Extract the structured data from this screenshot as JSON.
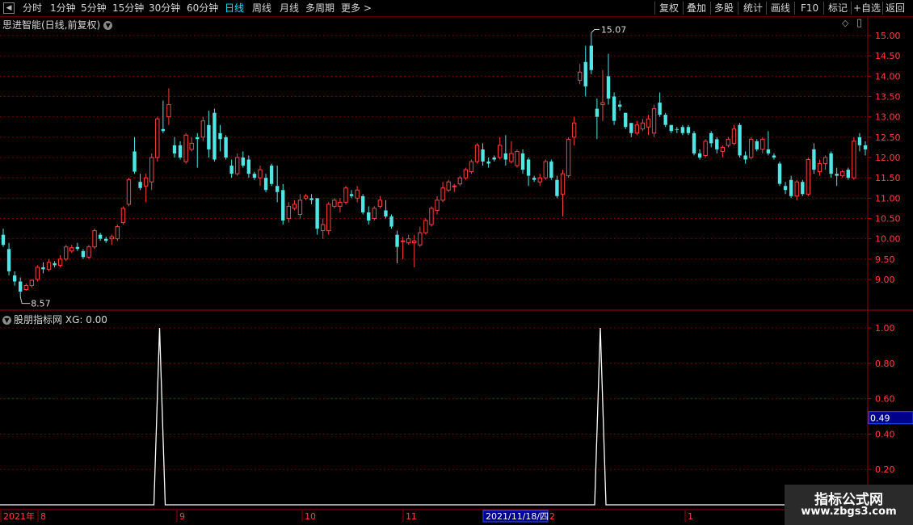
{
  "toolbar": {
    "periods": [
      "分时",
      "1分钟",
      "5分钟",
      "15分钟",
      "30分钟",
      "60分钟",
      "日线",
      "周线",
      "月线",
      "多周期",
      "更多"
    ],
    "active_period": "日线",
    "actions": [
      "复权",
      "叠加",
      "多股",
      "统计",
      "画线",
      "F10",
      "标记",
      "+自选",
      "返回"
    ]
  },
  "main_panel": {
    "title": "思进智能(日线,前复权)",
    "y_labels": [
      "15.00",
      "14.50",
      "14.00",
      "13.50",
      "13.00",
      "12.50",
      "12.00",
      "11.50",
      "11.00",
      "10.50",
      "10.00",
      "9.50",
      "9.00"
    ],
    "high_label": "15.07",
    "low_label": "8.57"
  },
  "indicator_panel": {
    "title": "股朋指标网",
    "series_label": "XG: 0.00",
    "y_labels": [
      "1.00",
      "0.80",
      "0.60",
      "0.40",
      "0.20"
    ],
    "cursor_value": "0.49"
  },
  "x_axis": {
    "labels": [
      "2021年",
      "8",
      "9",
      "10",
      "11",
      "2",
      "1"
    ],
    "cursor_date": "2021/11/18/四"
  },
  "watermark": {
    "title": "指标公式网",
    "url": "www.zbgs3.com"
  },
  "colors": {
    "up": "#ff4040",
    "down": "#50e6e6",
    "grid": "#6e0000",
    "cursor": "#00008b"
  },
  "chart_data": {
    "type": "candlestick",
    "title": "思进智能(日线,前复权)",
    "ylim": [
      8.3,
      15.3
    ],
    "candles_ohlc": [
      [
        10.1,
        10.25,
        9.8,
        9.85
      ],
      [
        9.75,
        9.9,
        9.1,
        9.2
      ],
      [
        9.1,
        9.2,
        8.85,
        8.95
      ],
      [
        8.95,
        9.05,
        8.57,
        8.7
      ],
      [
        8.75,
        8.9,
        8.72,
        8.85
      ],
      [
        8.85,
        9.0,
        8.8,
        8.98
      ],
      [
        9.0,
        9.35,
        8.95,
        9.3
      ],
      [
        9.3,
        9.42,
        9.15,
        9.25
      ],
      [
        9.25,
        9.5,
        9.2,
        9.42
      ],
      [
        9.4,
        9.45,
        9.3,
        9.35
      ],
      [
        9.35,
        9.6,
        9.3,
        9.5
      ],
      [
        9.5,
        9.85,
        9.45,
        9.8
      ],
      [
        9.7,
        9.85,
        9.65,
        9.78
      ],
      [
        9.8,
        9.9,
        9.7,
        9.75
      ],
      [
        9.7,
        9.75,
        9.5,
        9.55
      ],
      [
        9.55,
        9.85,
        9.5,
        9.8
      ],
      [
        9.8,
        10.25,
        9.75,
        10.2
      ],
      [
        10.1,
        10.15,
        9.95,
        10.0
      ],
      [
        10.0,
        10.05,
        9.9,
        9.95
      ],
      [
        10.0,
        10.1,
        9.85,
        10.05
      ],
      [
        10.0,
        10.35,
        9.95,
        10.3
      ],
      [
        10.4,
        10.8,
        10.35,
        10.75
      ],
      [
        10.85,
        11.5,
        10.8,
        11.45
      ],
      [
        12.15,
        12.5,
        11.6,
        11.65
      ],
      [
        11.4,
        11.6,
        11.2,
        11.25
      ],
      [
        11.3,
        11.6,
        10.9,
        11.5
      ],
      [
        11.4,
        12.1,
        11.2,
        12.0
      ],
      [
        12.0,
        13.0,
        11.9,
        12.95
      ],
      [
        12.7,
        13.4,
        12.6,
        12.65
      ],
      [
        13.0,
        13.7,
        12.8,
        13.3
      ],
      [
        12.3,
        12.5,
        12.0,
        12.1
      ],
      [
        12.3,
        12.4,
        11.95,
        12.0
      ],
      [
        11.9,
        12.6,
        11.85,
        12.55
      ],
      [
        12.2,
        12.5,
        12.15,
        12.35
      ],
      [
        12.5,
        12.6,
        11.75,
        12.45
      ],
      [
        12.5,
        13.0,
        12.4,
        12.9
      ],
      [
        12.8,
        13.15,
        12.0,
        12.2
      ],
      [
        13.1,
        13.2,
        11.9,
        11.95
      ],
      [
        12.6,
        12.8,
        12.15,
        12.45
      ],
      [
        12.5,
        12.55,
        11.95,
        12.0
      ],
      [
        11.8,
        11.95,
        11.5,
        11.6
      ],
      [
        11.6,
        12.1,
        11.55,
        12.0
      ],
      [
        12.0,
        12.15,
        11.75,
        11.8
      ],
      [
        11.95,
        12.05,
        11.5,
        11.6
      ],
      [
        11.6,
        11.65,
        11.45,
        11.5
      ],
      [
        11.5,
        11.8,
        11.3,
        11.7
      ],
      [
        11.5,
        11.6,
        11.15,
        11.2
      ],
      [
        11.8,
        11.85,
        11.3,
        11.35
      ],
      [
        11.3,
        11.8,
        10.9,
        11.15
      ],
      [
        11.2,
        11.35,
        10.35,
        10.45
      ],
      [
        10.5,
        10.9,
        10.4,
        10.8
      ],
      [
        10.75,
        10.95,
        10.7,
        10.85
      ],
      [
        10.6,
        11.1,
        10.5,
        10.95
      ],
      [
        11.0,
        11.1,
        10.95,
        11.05
      ],
      [
        11.0,
        11.1,
        10.85,
        10.95
      ],
      [
        11.0,
        11.0,
        10.1,
        10.25
      ],
      [
        10.2,
        10.5,
        10.0,
        10.35
      ],
      [
        10.2,
        10.9,
        10.1,
        10.85
      ],
      [
        10.8,
        11.0,
        10.75,
        10.95
      ],
      [
        10.8,
        11.0,
        10.65,
        10.9
      ],
      [
        10.9,
        11.3,
        10.85,
        11.25
      ],
      [
        11.1,
        11.2,
        11.0,
        11.05
      ],
      [
        11.0,
        11.3,
        10.9,
        11.2
      ],
      [
        11.05,
        11.1,
        10.6,
        10.65
      ],
      [
        10.65,
        10.8,
        10.35,
        10.45
      ],
      [
        10.5,
        10.8,
        10.45,
        10.75
      ],
      [
        10.8,
        11.05,
        10.75,
        10.95
      ],
      [
        10.7,
        10.95,
        10.5,
        10.55
      ],
      [
        10.55,
        10.6,
        10.25,
        10.3
      ],
      [
        10.1,
        10.2,
        9.4,
        9.8
      ],
      [
        9.95,
        10.05,
        9.5,
        9.95
      ],
      [
        9.9,
        10.1,
        9.85,
        10.0
      ],
      [
        9.9,
        10.1,
        9.3,
        9.95
      ],
      [
        9.85,
        10.3,
        9.8,
        10.15
      ],
      [
        10.15,
        10.5,
        10.1,
        10.45
      ],
      [
        10.35,
        10.8,
        10.3,
        10.75
      ],
      [
        10.7,
        11.05,
        10.6,
        10.95
      ],
      [
        10.95,
        11.4,
        10.9,
        11.25
      ],
      [
        11.2,
        11.45,
        11.15,
        11.4
      ],
      [
        11.3,
        11.35,
        11.15,
        11.3
      ],
      [
        11.35,
        11.55,
        11.3,
        11.5
      ],
      [
        11.5,
        11.75,
        11.45,
        11.7
      ],
      [
        11.65,
        11.95,
        11.6,
        11.9
      ],
      [
        11.9,
        12.35,
        11.85,
        12.3
      ],
      [
        12.2,
        12.35,
        11.8,
        11.9
      ],
      [
        11.9,
        12.0,
        11.75,
        11.85
      ],
      [
        12.0,
        12.05,
        11.9,
        11.95
      ],
      [
        12.0,
        12.5,
        11.95,
        12.3
      ],
      [
        12.1,
        12.55,
        11.8,
        11.95
      ],
      [
        11.9,
        12.4,
        11.85,
        12.1
      ],
      [
        11.8,
        12.2,
        11.75,
        12.15
      ],
      [
        12.1,
        12.2,
        11.6,
        11.7
      ],
      [
        11.95,
        12.0,
        11.3,
        11.55
      ],
      [
        11.5,
        11.55,
        11.4,
        11.45
      ],
      [
        11.4,
        11.6,
        11.3,
        11.5
      ],
      [
        11.5,
        11.95,
        11.45,
        11.9
      ],
      [
        11.9,
        11.95,
        11.45,
        11.5
      ],
      [
        11.45,
        11.55,
        11.0,
        11.05
      ],
      [
        11.1,
        11.7,
        10.55,
        11.6
      ],
      [
        11.55,
        12.5,
        11.5,
        12.45
      ],
      [
        12.5,
        13.0,
        12.3,
        12.85
      ],
      [
        13.9,
        14.3,
        13.8,
        14.1
      ],
      [
        14.35,
        14.75,
        13.5,
        13.75
      ],
      [
        14.75,
        15.07,
        14.05,
        14.15
      ],
      [
        13.2,
        13.45,
        12.45,
        13.0
      ],
      [
        13.3,
        14.15,
        12.9,
        13.35
      ],
      [
        14.0,
        14.55,
        13.3,
        13.45
      ],
      [
        13.5,
        13.6,
        12.8,
        12.9
      ],
      [
        13.3,
        13.4,
        13.15,
        13.25
      ],
      [
        13.1,
        13.1,
        12.7,
        12.75
      ],
      [
        12.85,
        12.85,
        12.5,
        12.6
      ],
      [
        12.6,
        12.9,
        12.55,
        12.8
      ],
      [
        12.7,
        12.95,
        12.65,
        12.85
      ],
      [
        12.75,
        13.05,
        12.55,
        12.95
      ],
      [
        12.6,
        13.3,
        12.5,
        13.2
      ],
      [
        13.35,
        13.6,
        13.0,
        13.05
      ],
      [
        13.05,
        13.1,
        12.75,
        12.8
      ],
      [
        12.8,
        12.8,
        12.6,
        12.65
      ],
      [
        12.7,
        12.75,
        12.6,
        12.68
      ],
      [
        12.75,
        12.8,
        12.55,
        12.6
      ],
      [
        12.75,
        12.8,
        12.55,
        12.6
      ],
      [
        12.6,
        12.65,
        12.05,
        12.1
      ],
      [
        12.1,
        12.2,
        11.95,
        12.0
      ],
      [
        12.05,
        12.45,
        12.0,
        12.4
      ],
      [
        12.6,
        12.65,
        12.25,
        12.35
      ],
      [
        12.45,
        12.5,
        12.1,
        12.2
      ],
      [
        12.15,
        12.3,
        12.0,
        12.25
      ],
      [
        12.3,
        12.5,
        12.25,
        12.45
      ],
      [
        12.35,
        12.8,
        12.3,
        12.7
      ],
      [
        12.8,
        12.85,
        12.0,
        12.05
      ],
      [
        12.05,
        12.15,
        11.85,
        11.95
      ],
      [
        12.0,
        12.5,
        11.95,
        12.45
      ],
      [
        12.4,
        12.45,
        12.15,
        12.2
      ],
      [
        12.2,
        12.5,
        12.1,
        12.45
      ],
      [
        12.2,
        12.65,
        12.05,
        12.1
      ],
      [
        12.05,
        12.1,
        11.95,
        12.0
      ],
      [
        11.85,
        11.9,
        11.3,
        11.35
      ],
      [
        11.3,
        11.4,
        11.1,
        11.2
      ],
      [
        11.45,
        11.55,
        11.0,
        11.05
      ],
      [
        11.05,
        11.45,
        10.95,
        11.4
      ],
      [
        11.4,
        11.45,
        11.05,
        11.1
      ],
      [
        11.1,
        12.0,
        11.05,
        11.95
      ],
      [
        12.2,
        12.35,
        11.6,
        11.7
      ],
      [
        11.65,
        11.95,
        11.55,
        11.85
      ],
      [
        11.85,
        12.05,
        11.7,
        12.0
      ],
      [
        12.1,
        12.15,
        11.5,
        11.6
      ],
      [
        11.6,
        11.75,
        11.3,
        11.55
      ],
      [
        11.55,
        11.7,
        11.5,
        11.65
      ],
      [
        11.7,
        11.75,
        11.45,
        11.5
      ],
      [
        11.5,
        12.5,
        11.45,
        12.4
      ],
      [
        12.5,
        12.6,
        12.15,
        12.3
      ],
      [
        12.3,
        12.4,
        12.05,
        12.2
      ]
    ],
    "xg_peaks": [
      {
        "after_label": "8",
        "before_label": "9",
        "value": 1.0
      },
      {
        "after_label": "2021/11/18/四",
        "before_label": "2",
        "value": 1.0
      }
    ],
    "xg_ylim": [
      0,
      1.1
    ]
  }
}
